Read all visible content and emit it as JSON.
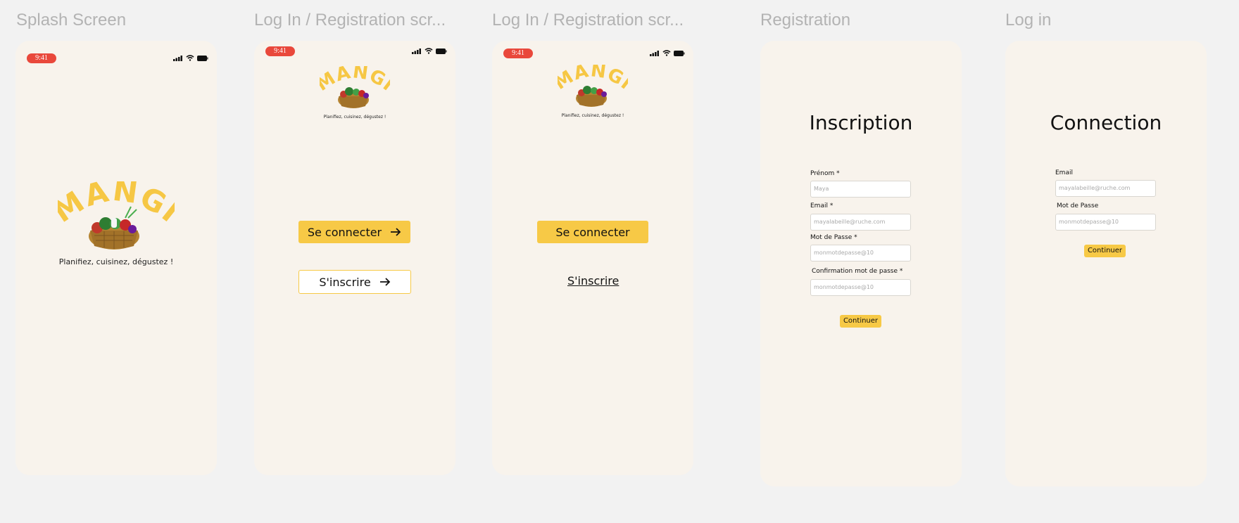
{
  "frames": {
    "splash_title": "Splash Screen",
    "login_reg_1_title": "Log In / Registration scr...",
    "login_reg_2_title": "Log In / Registration scr...",
    "registration_title": "Registration",
    "login_title": "Log in"
  },
  "status": {
    "time": "9:41"
  },
  "brand": {
    "logo_text": "MANGI",
    "tagline": "Planifiez, cuisinez, dégustez !",
    "accent": "#f7c946",
    "status_red": "#e9483b",
    "phone_bg": "#f8f3ec"
  },
  "auth_choice": {
    "login_label": "Se connecter",
    "signup_label": "S'inscrire"
  },
  "registration": {
    "heading": "Inscription",
    "firstname_label": "Prénom *",
    "firstname_placeholder": "Maya",
    "email_label": "Email *",
    "email_placeholder": "mayalabeille@ruche.com",
    "password_label": "Mot de Passe *",
    "password_placeholder": "monmotdepasse@10",
    "confirm_label": "Confirmation mot de passe *",
    "confirm_placeholder": "monmotdepasse@10",
    "continue_label": "Continuer"
  },
  "login": {
    "heading": "Connection",
    "email_label": "Email",
    "email_placeholder": "mayalabeille@ruche.com",
    "password_label": "Mot de Passe",
    "password_placeholder": "monmotdepasse@10",
    "continue_label": "Continuer"
  }
}
